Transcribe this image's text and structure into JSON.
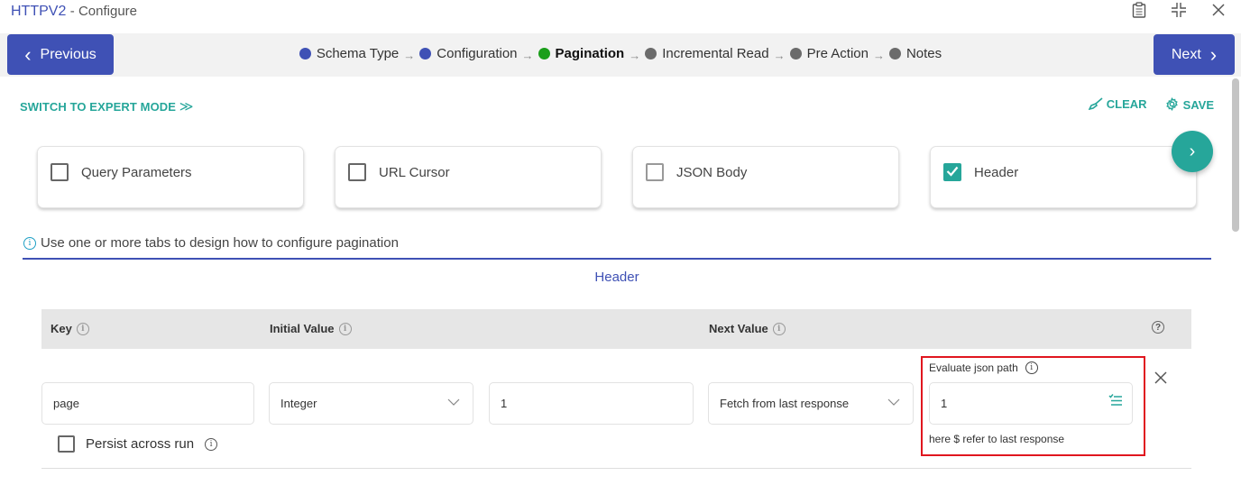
{
  "window": {
    "app_name": "HTTPV2",
    "subtitle": "- Configure",
    "icons": [
      "clipboard-icon",
      "collapse-icon",
      "close-icon"
    ],
    "icon_glyphs": {
      "clipboard": "📋",
      "collapse": "⊹",
      "close": "✕"
    }
  },
  "nav": {
    "previous_label": "Previous",
    "previous_glyph": "‹",
    "next_label": "Next",
    "next_glyph": "›",
    "arrow_glyph": "→",
    "steps": [
      {
        "label": "Schema Type",
        "status": "done",
        "color": "#3f51b5"
      },
      {
        "label": "Configuration",
        "status": "done",
        "color": "#3f51b5"
      },
      {
        "label": "Pagination",
        "status": "active",
        "color": "#1a9e1a"
      },
      {
        "label": "Incremental Read",
        "status": "pending",
        "color": "#6b6b6b"
      },
      {
        "label": "Pre Action",
        "status": "pending",
        "color": "#6b6b6b"
      },
      {
        "label": "Notes",
        "status": "pending",
        "color": "#6b6b6b"
      }
    ]
  },
  "toolbar": {
    "expert_mode_label": "SWITCH TO EXPERT MODE",
    "expert_mode_glyph": "≫",
    "clear_label": "CLEAR",
    "clear_glyph": "🧹",
    "save_label": "SAVE",
    "save_glyph": "⚙"
  },
  "pagination_types": [
    {
      "label": "Query Parameters",
      "checked": false
    },
    {
      "label": "URL Cursor",
      "checked": false
    },
    {
      "label": "JSON Body",
      "checked": false
    },
    {
      "label": "Header",
      "checked": true
    }
  ],
  "fab_glyph": "›",
  "hint": "Use one or more tabs to design how to configure pagination",
  "info_glyph": "i",
  "active_tab_title": "Header",
  "table": {
    "columns": [
      "Key",
      "Initial Value",
      "Next Value"
    ],
    "help_glyph": "?",
    "rows": [
      {
        "key": "page",
        "initial_type": "Integer",
        "initial_value": "1",
        "next_value_mode": "Fetch from last response",
        "evaluate_label": "Evaluate json path",
        "evaluate_value": "1",
        "evaluate_help": "here $ refer to last response",
        "persist_label": "Persist across run",
        "persist_checked": false
      }
    ],
    "close_glyph": "✕",
    "chevron_glyph": "⌵",
    "json_icon_glyph": "☰"
  },
  "highlight_color": "#e0161f",
  "accent_color": "#3f51b5",
  "teal_color": "#26a69a"
}
